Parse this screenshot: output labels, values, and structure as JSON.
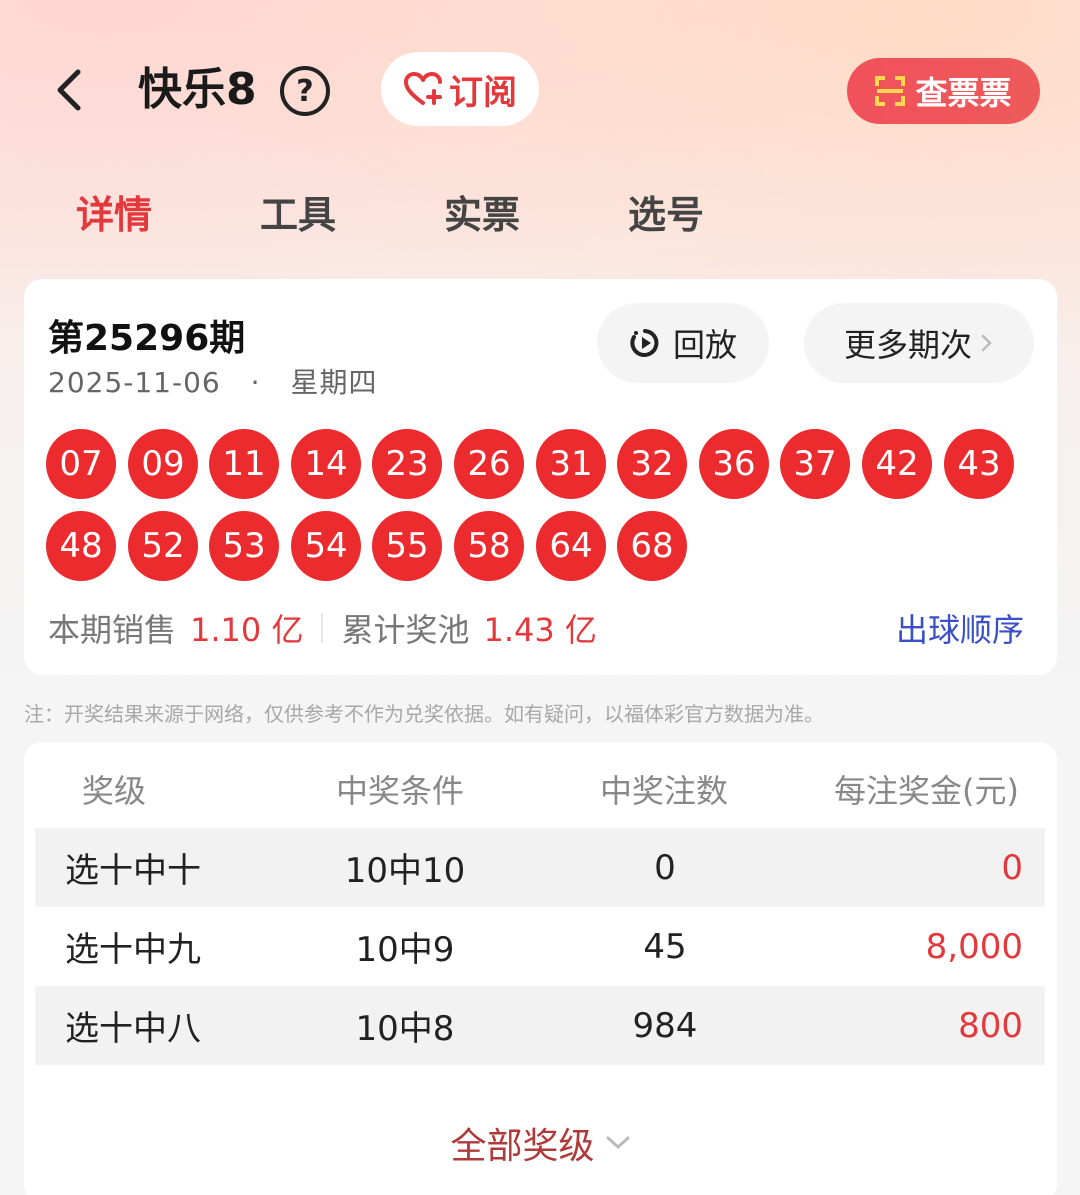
{
  "header": {
    "title": "快乐8",
    "help": "?",
    "subscribe_label": "订阅",
    "check_ticket_label": "查票票"
  },
  "tabs": [
    {
      "label": "详情",
      "active": true
    },
    {
      "label": "工具",
      "active": false
    },
    {
      "label": "实票",
      "active": false
    },
    {
      "label": "选号",
      "active": false
    }
  ],
  "draw": {
    "issue": "第25296期",
    "date": "2025-11-06",
    "dot": "·",
    "weekday": "星期四",
    "replay_label": "回放",
    "more_label": "更多期次",
    "numbers": [
      "07",
      "09",
      "11",
      "14",
      "23",
      "26",
      "31",
      "32",
      "36",
      "37",
      "42",
      "43",
      "48",
      "52",
      "53",
      "54",
      "55",
      "58",
      "64",
      "68"
    ],
    "sales_label": "本期销售",
    "sales_value": "1.10 亿",
    "pool_label": "累计奖池",
    "pool_value": "1.43 亿",
    "order_label": "出球顺序"
  },
  "note": "注：开奖结果来源于网络，仅供参考不作为兑奖依据。如有疑问，以福体彩官方数据为准。",
  "prize_table": {
    "headers": [
      "奖级",
      "中奖条件",
      "中奖注数",
      "每注奖金(元)"
    ],
    "rows": [
      {
        "level": "选十中十",
        "condition": "10中10",
        "count": "0",
        "amount": "0"
      },
      {
        "level": "选十中九",
        "condition": "10中9",
        "count": "45",
        "amount": "8,000"
      },
      {
        "level": "选十中八",
        "condition": "10中8",
        "count": "984",
        "amount": "800"
      }
    ],
    "all_levels_label": "全部奖级"
  },
  "colors": {
    "accent_red": "#e4393c",
    "ball_red": "#ec2b2f",
    "link_blue": "#3a4fc8"
  }
}
